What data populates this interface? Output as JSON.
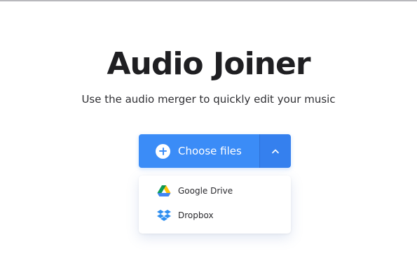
{
  "page": {
    "title": "Audio Joiner",
    "subtitle": "Use the audio merger to quickly edit your music"
  },
  "upload": {
    "choose_label": "Choose files",
    "plus_icon": "plus-circle-icon",
    "toggle_icon": "chevron-up-icon",
    "dropdown_open": true
  },
  "menu": {
    "items": [
      {
        "label": "Google Drive",
        "icon": "google-drive-icon"
      },
      {
        "label": "Dropbox",
        "icon": "dropbox-icon"
      }
    ]
  },
  "colors": {
    "accent": "#3b8cf7",
    "accent_dark": "#3580ee",
    "title": "#1f1f22",
    "text": "#2f2f33",
    "background": "#ffffff"
  }
}
